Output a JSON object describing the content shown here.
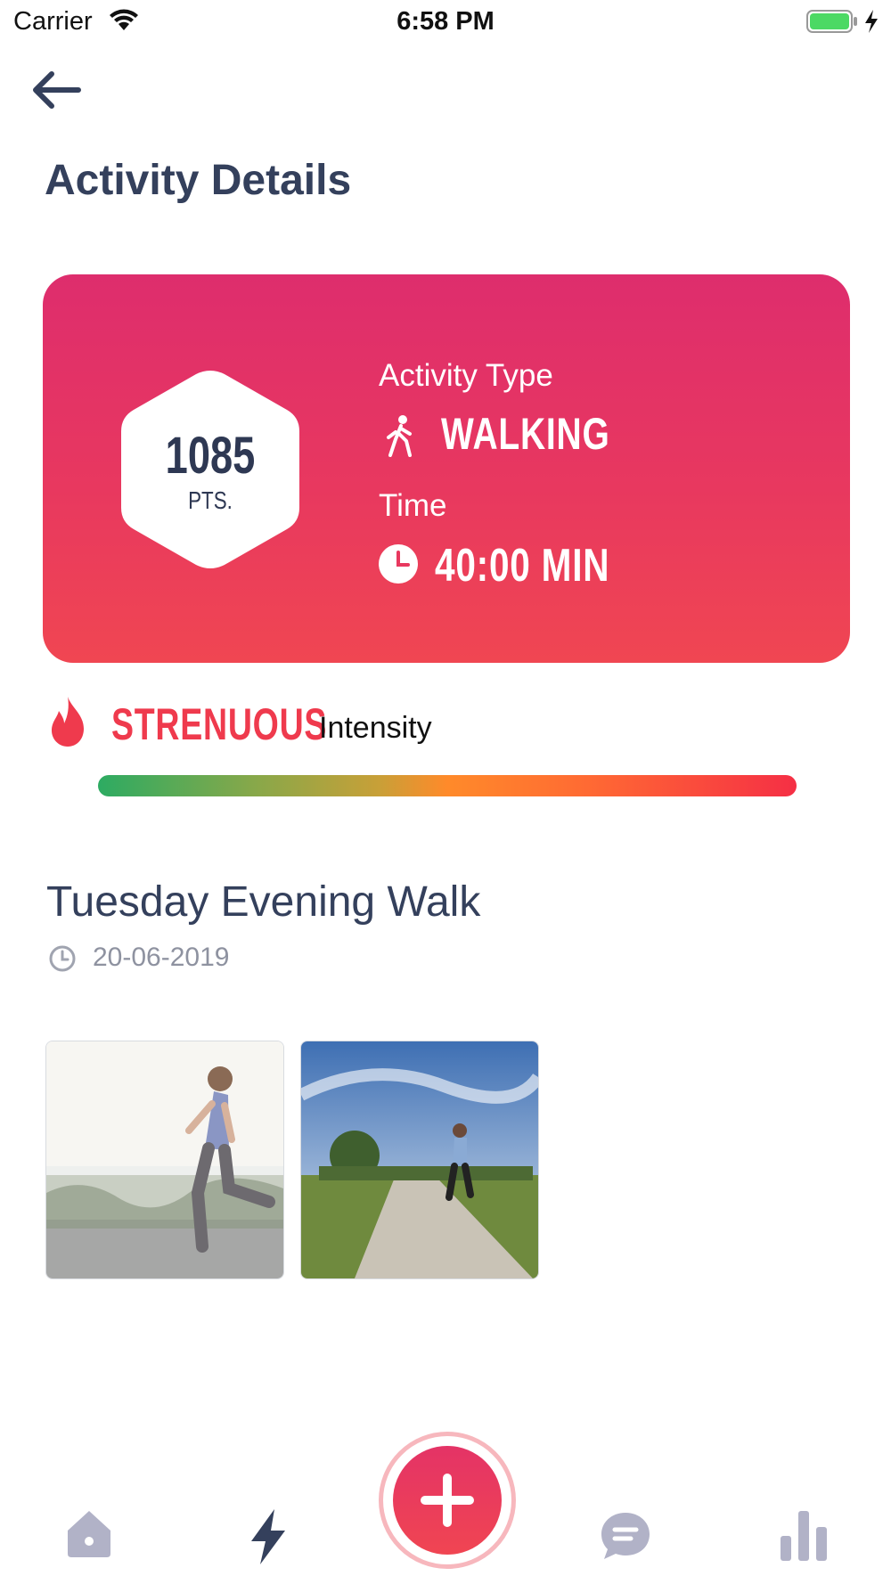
{
  "status_bar": {
    "carrier": "Carrier",
    "time": "6:58 PM"
  },
  "header": {
    "title": "Activity Details"
  },
  "card": {
    "points": "1085",
    "points_unit": "PTS.",
    "activity_type_label": "Activity Type",
    "activity_type": "WALKING",
    "time_label": "Time",
    "time_value": "40:00 MIN"
  },
  "intensity": {
    "level": "STRENUOUS",
    "label": "Intensity",
    "level_fraction": 1.0
  },
  "activity": {
    "title": "Tuesday Evening Walk",
    "date": "20-06-2019"
  },
  "photos": [
    {
      "alt": "Woman jogging"
    },
    {
      "alt": "Man running on dirt road"
    }
  ],
  "icons": {
    "back": "back-arrow-icon",
    "walk": "walking-icon",
    "clock": "clock-icon",
    "flame": "flame-icon",
    "home": "home-icon",
    "activity": "lightning-icon",
    "add": "plus-icon",
    "chat": "chat-icon",
    "stats": "bar-chart-icon"
  },
  "colors": {
    "card_top": "#de2d6d",
    "card_bottom": "#f04652",
    "accent": "#ef3a4d",
    "title": "#34405c",
    "nav_inactive": "#b1b2c7"
  }
}
